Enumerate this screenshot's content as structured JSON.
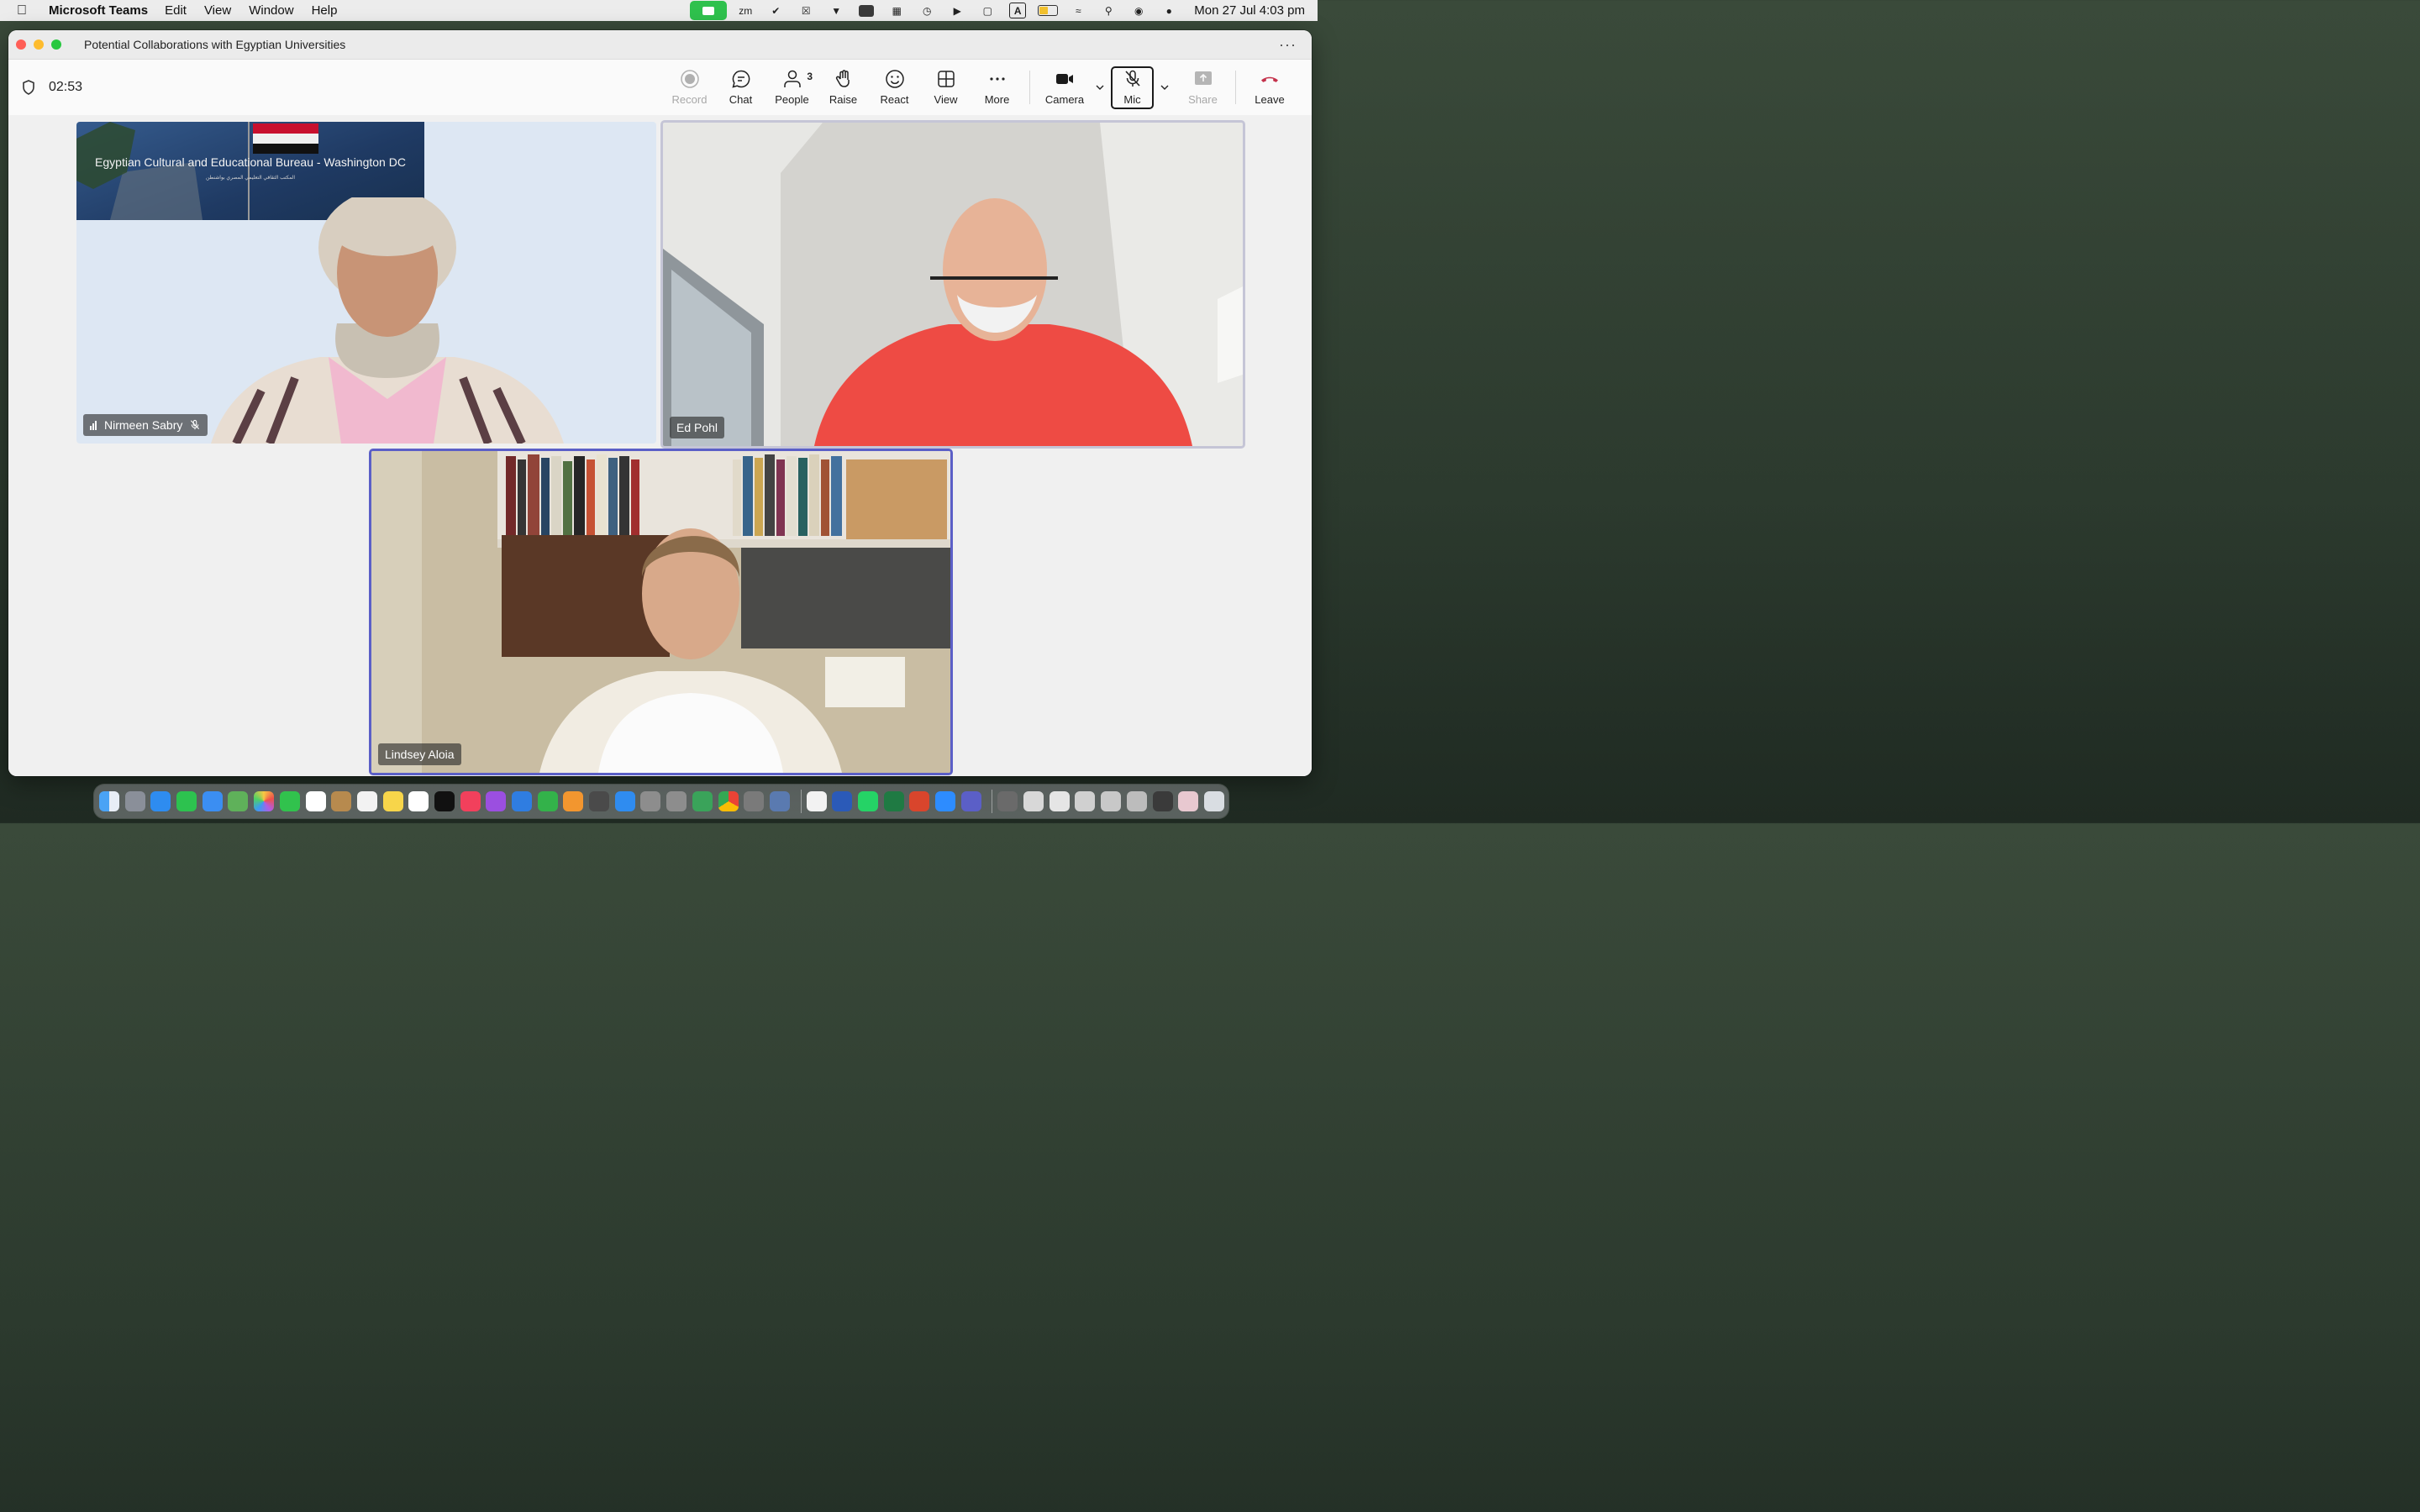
{
  "menubar": {
    "app_name": "Microsoft Teams",
    "menus": [
      "Edit",
      "View",
      "Window",
      "Help"
    ],
    "clock": "Mon 27 Jul  4:03 pm"
  },
  "window": {
    "title": "Potential Collaborations with Egyptian Universities"
  },
  "toolbar": {
    "timer": "02:53",
    "record": "Record",
    "chat": "Chat",
    "people": "People",
    "people_count": "3",
    "raise": "Raise",
    "react": "React",
    "view": "View",
    "more": "More",
    "camera": "Camera",
    "mic": "Mic",
    "share": "Share",
    "leave": "Leave"
  },
  "participants": [
    {
      "name": "Nirmeen Sabry",
      "muted": true
    },
    {
      "name": "Ed Pohl",
      "muted": false
    },
    {
      "name": "Lindsey Aloia",
      "muted": false
    }
  ],
  "presentation_banner": {
    "title": "Egyptian Cultural and Educational Bureau - Washington DC",
    "subtitle": "المكتب الثقافي التعليمي المصري بواشنطن"
  },
  "colors": {
    "accent": "#5b5fc7",
    "leave_red": "#c4314b",
    "camera_status_green": "#2fc14d"
  }
}
